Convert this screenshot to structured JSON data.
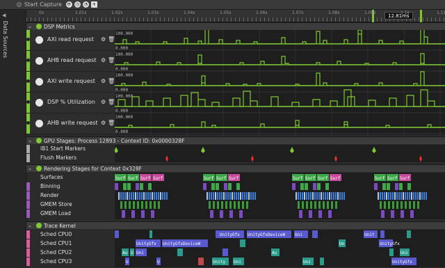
{
  "toolbar": {
    "capture_label": "Start Capture",
    "zoom_badge": "12.81ms"
  },
  "ruler": {
    "ticks": [
      "0s",
      "1.01s",
      "1.02s",
      "1.03s",
      "1.04s",
      "1.05s",
      "1.06s",
      "1.07s",
      "1.08s",
      "1.09s",
      "1.1s",
      "1.11s"
    ]
  },
  "sidebar": {
    "title": "Data Sources"
  },
  "groups": {
    "dsp": "DSP Metrics",
    "gpu": "GPU Stages: Process 12893 - Context ID: 0x0000328F",
    "render": "Rendering Stages for Context 0x328F",
    "trace": "Trace Kernel"
  },
  "metrics": [
    {
      "label": "AXI read request",
      "max": "100.000",
      "min": "0.000"
    },
    {
      "label": "AHB read request",
      "max": "100.000",
      "min": "0.000"
    },
    {
      "label": "AXI write request",
      "max": "100.000",
      "min": "0.000"
    },
    {
      "label": "DSP % Utilization",
      "max": "100.000",
      "min": "0.000"
    },
    {
      "label": "AHB write request",
      "max": "100.000",
      "min": "0.000"
    }
  ],
  "gpu_rows": [
    "IB1 Start Markers",
    "Flush Markers"
  ],
  "render_rows": [
    "Surfaces",
    "Binning",
    "Render",
    "GMEM Store",
    "GMEM Load"
  ],
  "trace_rows": [
    "Sched CPU0",
    "Sched CPU1",
    "Sched CPU2",
    "Sched CPU3"
  ],
  "surfaces_text": "Surf",
  "cpu_labels": {
    "unity_gfx": "UnityGfx",
    "unity_gfx_device": "UnityGfxDeviceW",
    "unity": "Unity",
    "uni": "Uni",
    "u": "U",
    "un": "Un",
    "au": "Au",
    "unit": "Unit",
    "unity_gfx_short": "UnityGfx",
    "r": "R"
  },
  "colors": {
    "accent_green": "#7ec832",
    "surf_green": "#3ea84a",
    "surf_pink": "#c84a9a",
    "render_blue": "#3a7ed8",
    "gmem_green": "#3c9a3a",
    "gmem_purple": "#7a4cc0",
    "cpu_blue": "#5a5ad0",
    "cpu_teal": "#2a9a8a"
  }
}
